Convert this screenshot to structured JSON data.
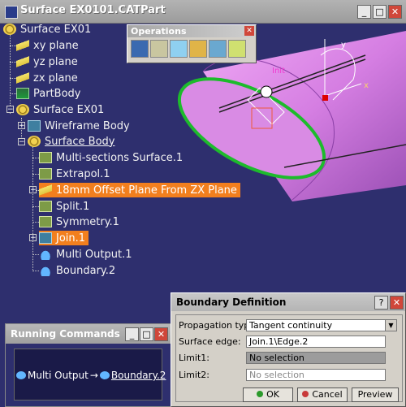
{
  "window": {
    "title": "Surface EX0101.CATPart"
  },
  "tree": {
    "root": "Surface EX01",
    "xy": "xy plane",
    "yz": "yz plane",
    "zx": "zx plane",
    "partbody": "PartBody",
    "surface_set": "Surface EX01",
    "wireframe": "Wireframe Body",
    "surface_body": "Surface Body",
    "items": [
      "Multi-sections Surface.1",
      "Extrapol.1",
      "18mm Offset Plane From ZX Plane",
      "Split.1",
      "Symmetry.1",
      "Join.1",
      "Multi Output.1",
      "Boundary.2"
    ]
  },
  "toolbar": {
    "title": "Operations"
  },
  "view": {
    "label_init": "Init",
    "axis_x": "x",
    "axis_y": "y"
  },
  "running": {
    "title": "Running Commands",
    "cmd1": "Multi Output",
    "cmd2": "Boundary.2"
  },
  "dialog": {
    "title": "Boundary Definition",
    "prop_label": "Propagation type:",
    "prop_value": "Tangent continuity",
    "edge_label": "Surface edge:",
    "edge_value": "Join.1\\Edge.2",
    "limit1_label": "Limit1:",
    "limit1_value": "No selection",
    "limit2_label": "Limit2:",
    "limit2_value": "No selection",
    "ok": "OK",
    "cancel": "Cancel",
    "preview": "Preview"
  },
  "colors": {
    "background": "#2e2f6e",
    "selection": "#f27f1e",
    "surface": "#d48ce0",
    "highlight": "#1dbb2c"
  }
}
